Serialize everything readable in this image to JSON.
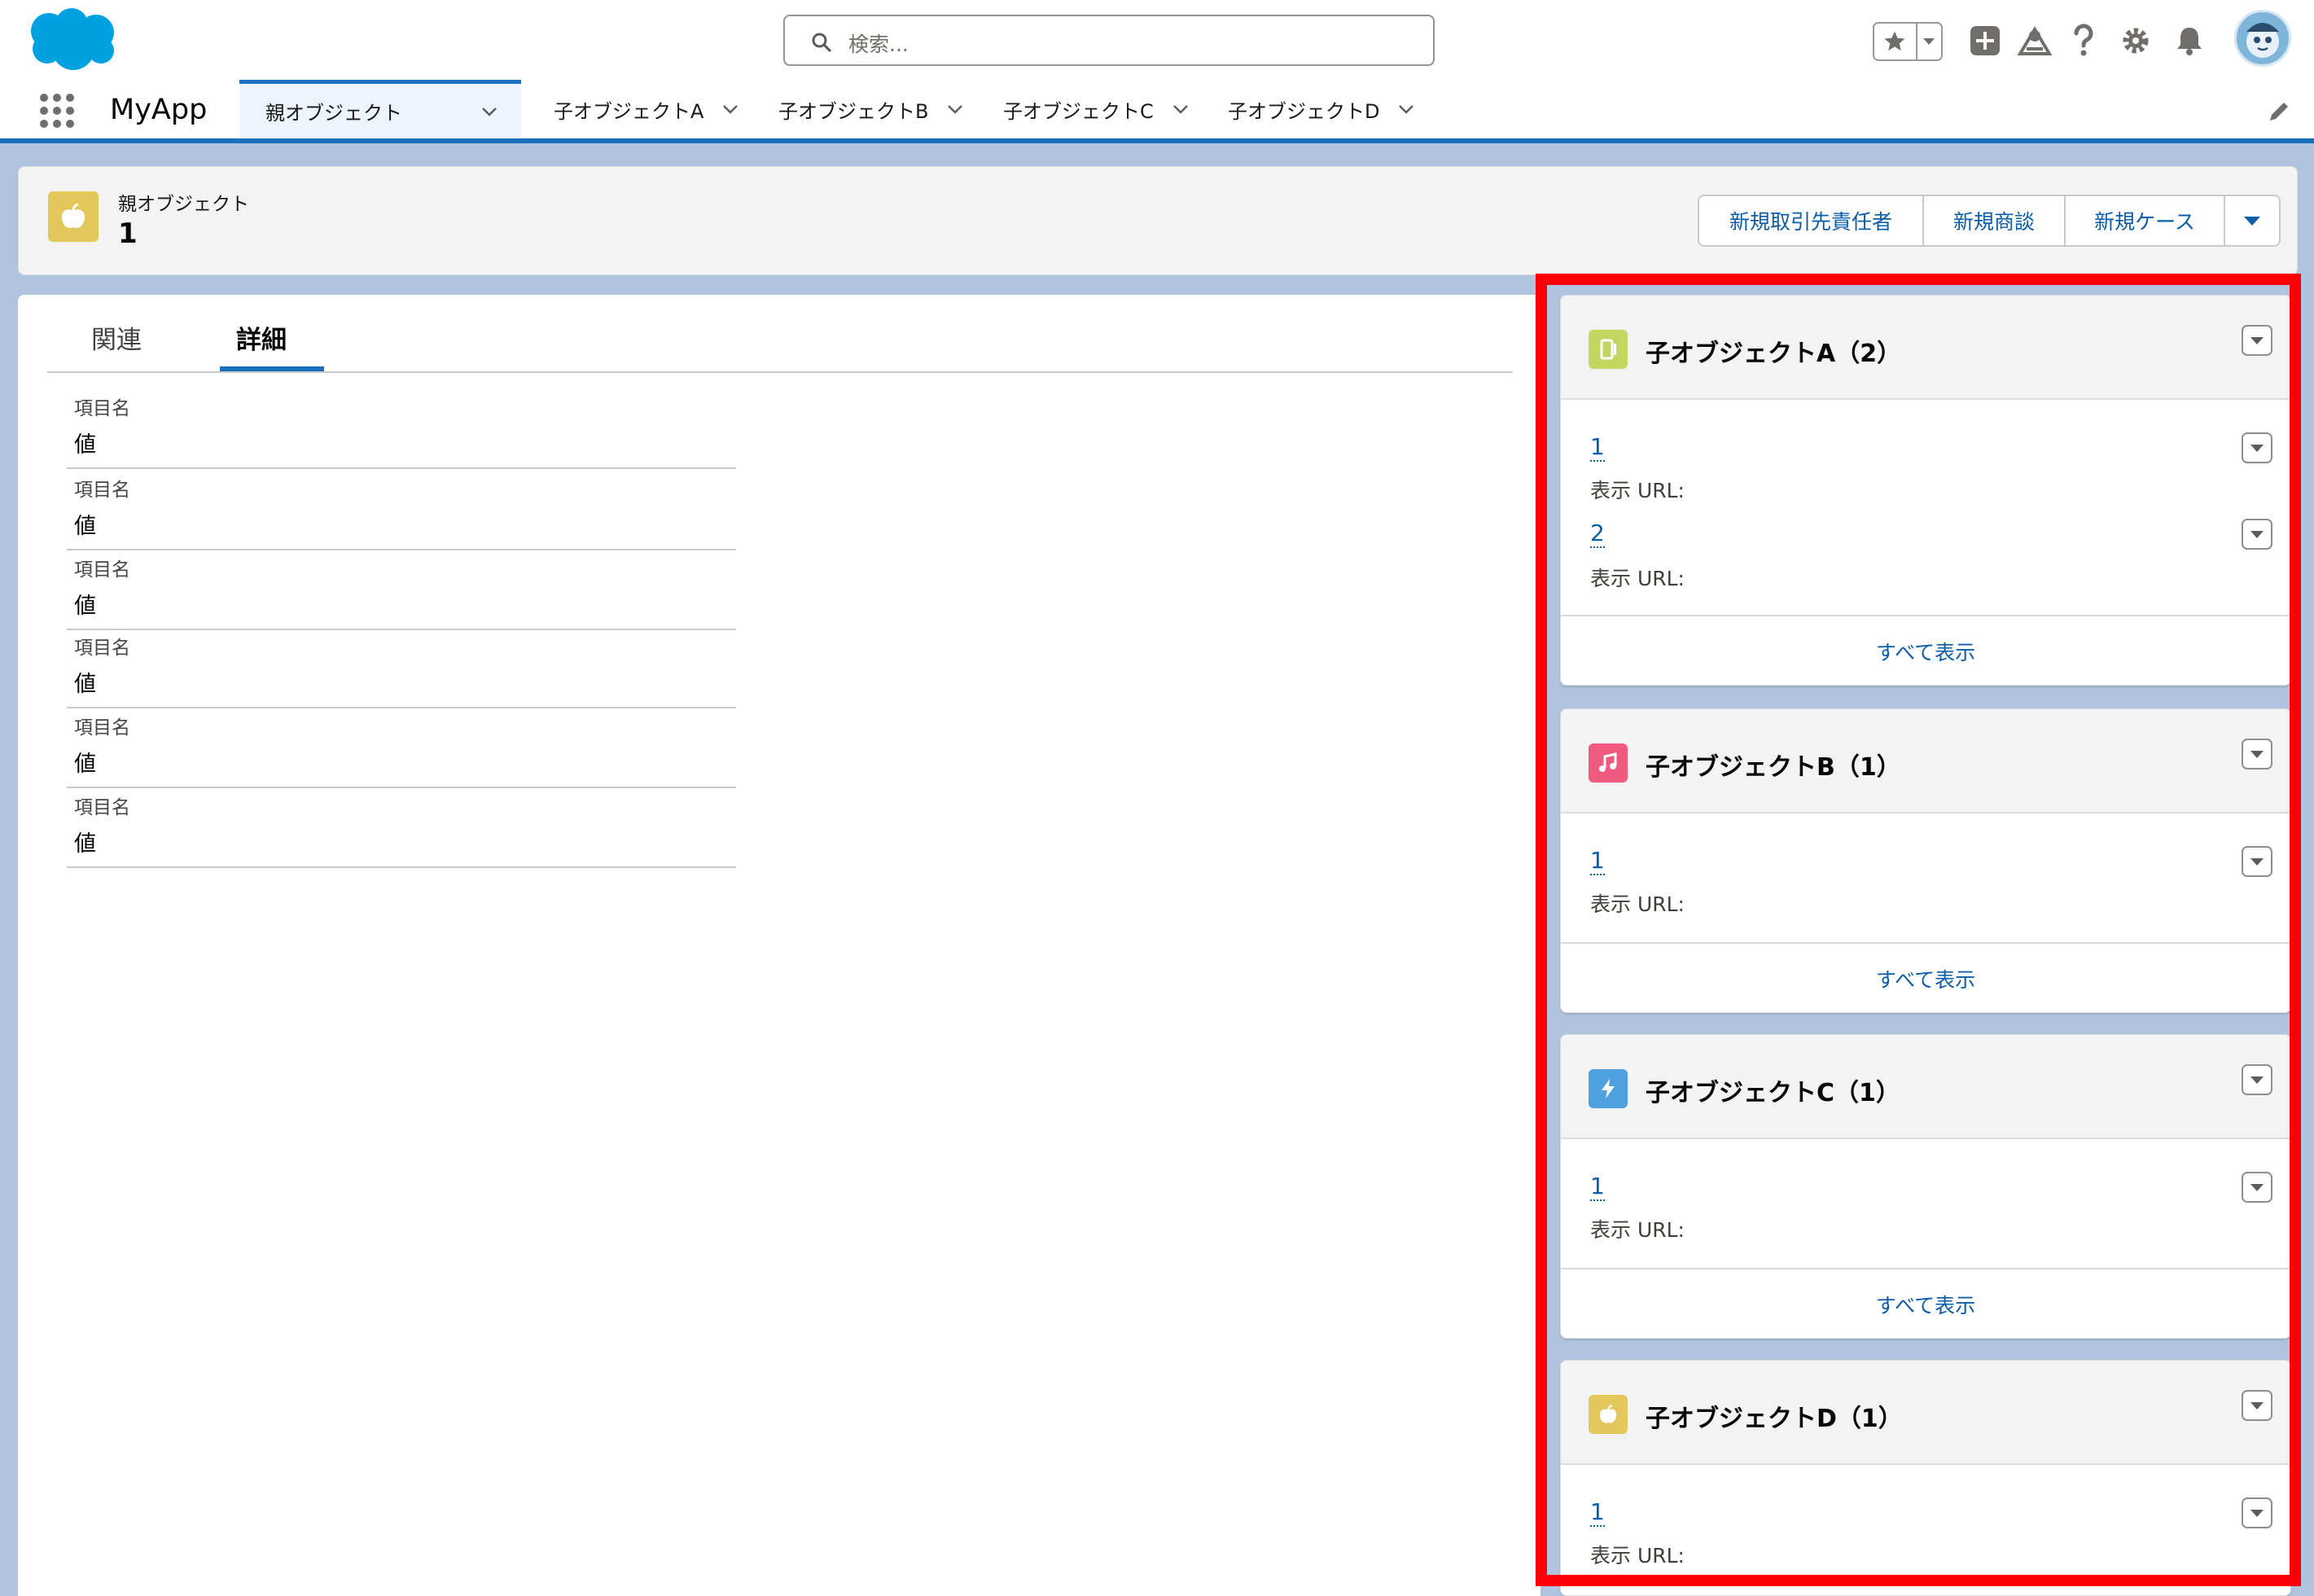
{
  "header": {
    "search_placeholder": "検索...",
    "icons": [
      "salesforce-cloud-logo",
      "search-icon",
      "star-icon",
      "chevron-down-icon",
      "plus-icon",
      "trailhead-icon",
      "help-icon",
      "gear-icon",
      "bell-icon",
      "avatar"
    ]
  },
  "nav": {
    "app_name": "MyApp",
    "tabs": [
      {
        "label": "親オブジェクト",
        "active": true
      },
      {
        "label": "子オブジェクトA"
      },
      {
        "label": "子オブジェクトB"
      },
      {
        "label": "子オブジェクトC"
      },
      {
        "label": "子オブジェクトD"
      }
    ]
  },
  "record": {
    "type_label": "親オブジェクト",
    "name": "1",
    "actions": [
      "新規取引先責任者",
      "新規商談",
      "新規ケース"
    ]
  },
  "main": {
    "tabs": [
      "関連",
      "詳細"
    ],
    "active_tab": "詳細",
    "fields": [
      {
        "label": "項目名",
        "value": "値"
      },
      {
        "label": "項目名",
        "value": "値"
      },
      {
        "label": "項目名",
        "value": "値"
      },
      {
        "label": "項目名",
        "value": "値"
      },
      {
        "label": "項目名",
        "value": "値"
      },
      {
        "label": "項目名",
        "value": "値"
      }
    ]
  },
  "related": [
    {
      "title": "子オブジェクトA（2）",
      "icon": "tablet-icon",
      "color": "#c2d660",
      "items": [
        {
          "link": "1",
          "url_label": "表示 URL:"
        },
        {
          "link": "2",
          "url_label": "表示 URL:"
        }
      ],
      "view_all": "すべて表示"
    },
    {
      "title": "子オブジェクトB（1）",
      "icon": "music-note-icon",
      "color": "#f05a7e",
      "items": [
        {
          "link": "1",
          "url_label": "表示 URL:"
        }
      ],
      "view_all": "すべて表示"
    },
    {
      "title": "子オブジェクトC（1）",
      "icon": "lightning-icon",
      "color": "#4ea0de",
      "items": [
        {
          "link": "1",
          "url_label": "表示 URL:"
        }
      ],
      "view_all": "すべて表示"
    },
    {
      "title": "子オブジェクトD（1）",
      "icon": "apple-icon",
      "color": "#e4c75a",
      "items": [
        {
          "link": "1",
          "url_label": "表示 URL:"
        }
      ]
    }
  ],
  "colors": {
    "brand_blue": "#1b6fbf",
    "link_blue": "#0b5cab",
    "highlight_red": "#fb0007",
    "record_icon": "#e4c75a"
  }
}
